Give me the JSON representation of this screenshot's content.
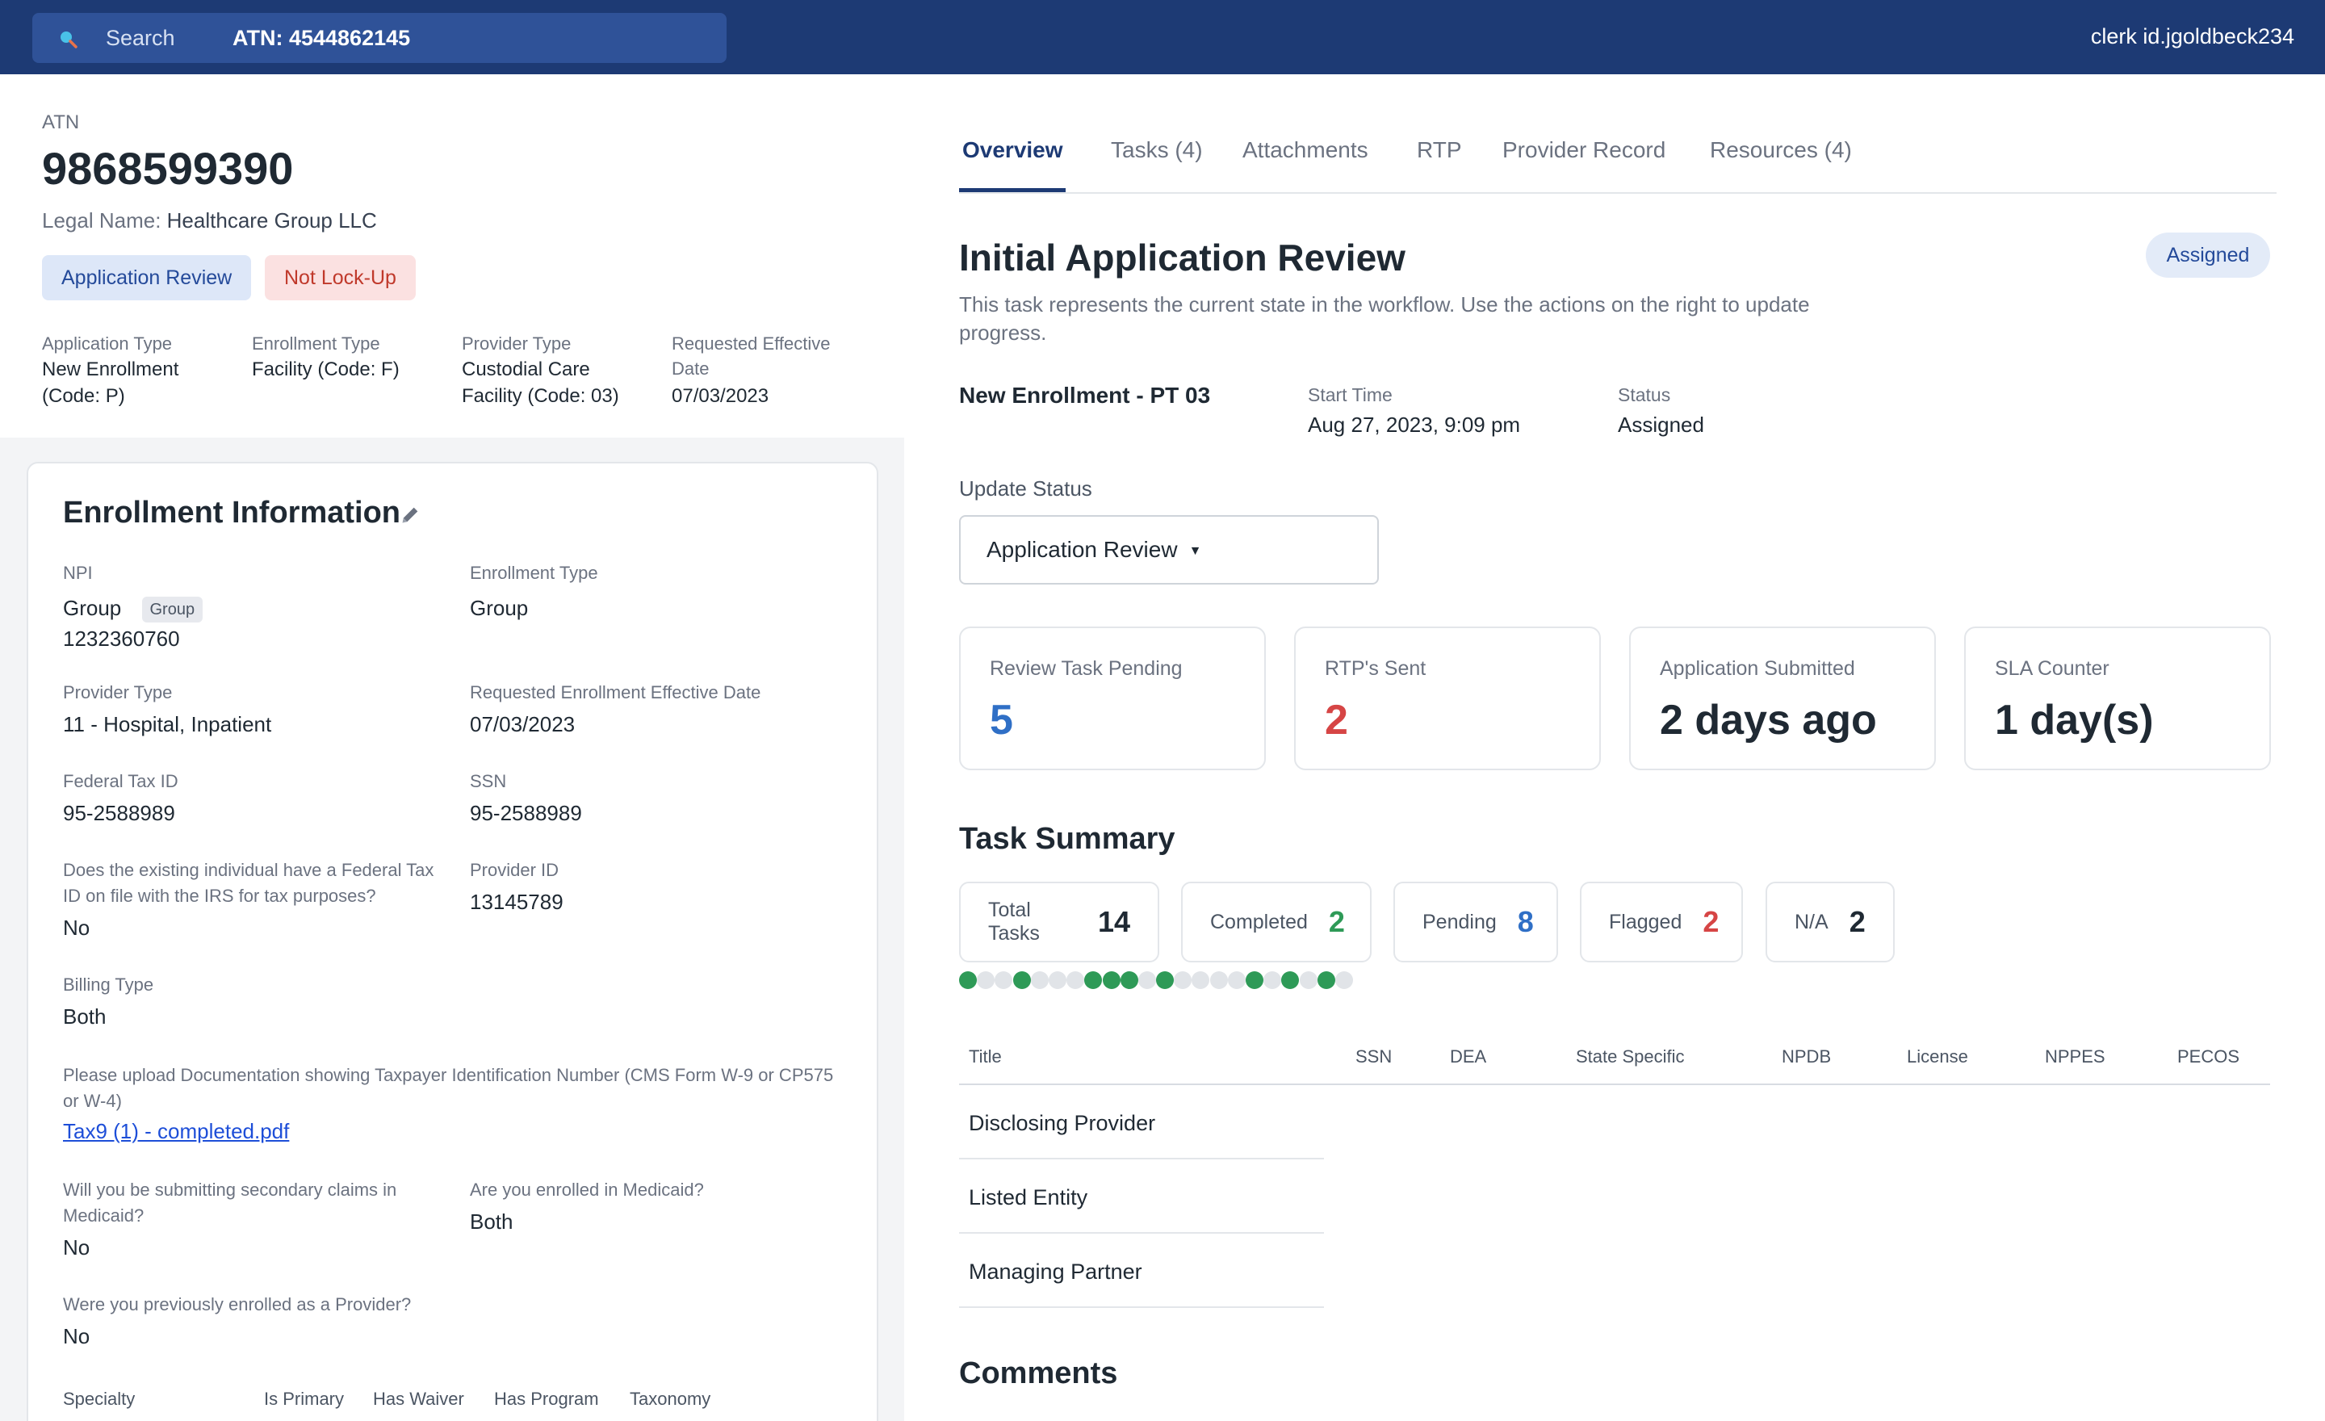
{
  "topbar": {
    "search_label": "Search",
    "search_value": "ATN: 4544862145",
    "user": "clerk id.jgoldbeck234"
  },
  "header": {
    "atn_label": "ATN",
    "atn_number": "9868599390",
    "legal_name_label": "Legal Name:",
    "legal_name_value": "Healthcare Group LLC",
    "pills": [
      "Application Review",
      "Not Lock-Up"
    ],
    "fields": [
      {
        "label": "Application Type",
        "value": "New Enrollment (Code: P)"
      },
      {
        "label": "Enrollment Type",
        "value": "Facility (Code: F)"
      },
      {
        "label": "Provider Type",
        "value": "Custodial Care Facility (Code: 03)"
      },
      {
        "label": "Requested Effective Date",
        "value": "07/03/2023"
      }
    ]
  },
  "enrollment": {
    "title": "Enrollment Information",
    "npi_label": "NPI",
    "npi_name": "Group",
    "npi_tag": "Group",
    "npi_number": "1232360760",
    "enrollment_type_label": "Enrollment Type",
    "enrollment_type_value": "Group",
    "provider_type_label": "Provider Type",
    "provider_type_value": "11 - Hospital, Inpatient",
    "req_date_label": "Requested Enrollment Effective Date",
    "req_date_value": "07/03/2023",
    "tax_id_label": "Federal Tax ID",
    "tax_id_value": "95-2588989",
    "ssn_label": "SSN",
    "ssn_value": "95-2588989",
    "irs_label": "Does the existing individual have a Federal Tax ID on file with the IRS for tax purposes?",
    "irs_value": "No",
    "provider_id_label": "Provider ID",
    "provider_id_value": "13145789",
    "billing_label": "Billing Type",
    "billing_value": "Both",
    "upload_label": "Please upload Documentation showing Taxpayer Identification Number (CMS Form W-9 or CP575 or W-4)",
    "upload_file": "Tax9 (1) - completed.pdf",
    "secondary_label": "Will you be submitting secondary claims in Medicaid?",
    "secondary_value": "No",
    "medicaid_label": "Are you enrolled in Medicaid?",
    "medicaid_value": "Both",
    "previous_label": "Were you previously enrolled as a Provider?",
    "previous_value": "No",
    "specialty_headers": [
      "Specialty",
      "Is Primary",
      "Has Waiver",
      "Has Program",
      "Taxonomy"
    ]
  },
  "tabs": [
    "Overview",
    "Tasks (4)",
    "Attachments",
    "RTP",
    "Provider Record",
    "Resources (4)"
  ],
  "task": {
    "title": "Initial Application Review",
    "badge": "Assigned",
    "description": "This task represents the current state in the workflow. Use the actions on the right to update progress.",
    "enrollment_name": "New Enrollment - PT 03",
    "start_time_label": "Start Time",
    "start_time_value": "Aug 27, 2023, 9:09 pm",
    "status_label": "Status",
    "status_value": "Assigned",
    "update_status_label": "Update Status",
    "update_status_value": "Application Review"
  },
  "stats": [
    {
      "label": "Review Task Pending",
      "value": "5"
    },
    {
      "label": "RTP's Sent",
      "value": "2"
    },
    {
      "label": "Application Submitted",
      "value": "2 days ago"
    },
    {
      "label": "SLA Counter",
      "value": "1 day(s)"
    }
  ],
  "task_summary": {
    "title": "Task Summary",
    "counts": [
      {
        "label": "Total Tasks",
        "value": "14"
      },
      {
        "label": "Completed",
        "value": "2"
      },
      {
        "label": "Pending",
        "value": "8"
      },
      {
        "label": "Flagged",
        "value": "2"
      },
      {
        "label": "N/A",
        "value": "2"
      }
    ],
    "progress_dots": [
      1,
      0,
      0,
      1,
      0,
      0,
      0,
      1,
      1,
      1,
      0,
      1,
      0,
      0,
      0,
      0,
      1,
      0,
      1,
      0,
      1,
      0
    ],
    "table_headers": [
      "Title",
      "SSN",
      "DEA",
      "State Specific",
      "NPDB",
      "License",
      "NPPES",
      "PECOS"
    ],
    "rows": [
      "Disclosing Provider",
      "Listed Entity",
      "Managing Partner"
    ]
  },
  "comments_title": "Comments",
  "colors": {
    "topbar": "#1d3a74",
    "search_bg": "#2f5298",
    "accent_blue": "#2f6fc6",
    "accent_red": "#d64545",
    "accent_green": "#2e9a57"
  },
  "icons": [
    "search-icon",
    "pencil-icon",
    "chevron-down-icon"
  ]
}
